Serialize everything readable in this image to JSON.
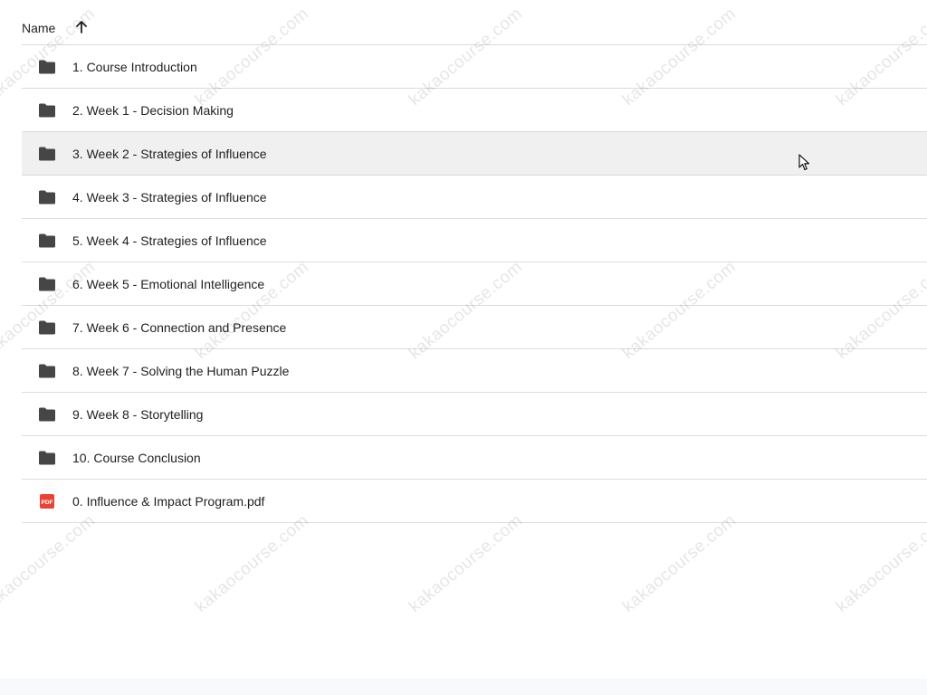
{
  "header": {
    "name_label": "Name",
    "sort_icon": "arrow-up-icon"
  },
  "rows": [
    {
      "label": "1. Course Introduction",
      "icon": "folder-icon"
    },
    {
      "label": "2. Week 1 - Decision Making",
      "icon": "folder-icon"
    },
    {
      "label": "3. Week 2 - Strategies of Influence",
      "icon": "folder-icon"
    },
    {
      "label": "4. Week 3 - Strategies of Influence",
      "icon": "folder-icon"
    },
    {
      "label": "5. Week 4 - Strategies of Influence",
      "icon": "folder-icon"
    },
    {
      "label": "6. Week 5 - Emotional Intelligence",
      "icon": "folder-icon"
    },
    {
      "label": "7. Week 6 - Connection and Presence",
      "icon": "folder-icon"
    },
    {
      "label": "8. Week 7 - Solving the Human Puzzle",
      "icon": "folder-icon"
    },
    {
      "label": "9. Week 8 - Storytelling",
      "icon": "folder-icon"
    },
    {
      "label": "10. Course Conclusion",
      "icon": "folder-icon"
    },
    {
      "label": "0. Influence & Impact Program.pdf",
      "icon": "pdf-icon",
      "icon_text": "PDF"
    }
  ],
  "watermark": "kakaocourse.com",
  "colors": {
    "folder": "#444746",
    "pdf": "#ea4335",
    "divider": "#dadce0",
    "hover_row": "#f0f0f0"
  }
}
